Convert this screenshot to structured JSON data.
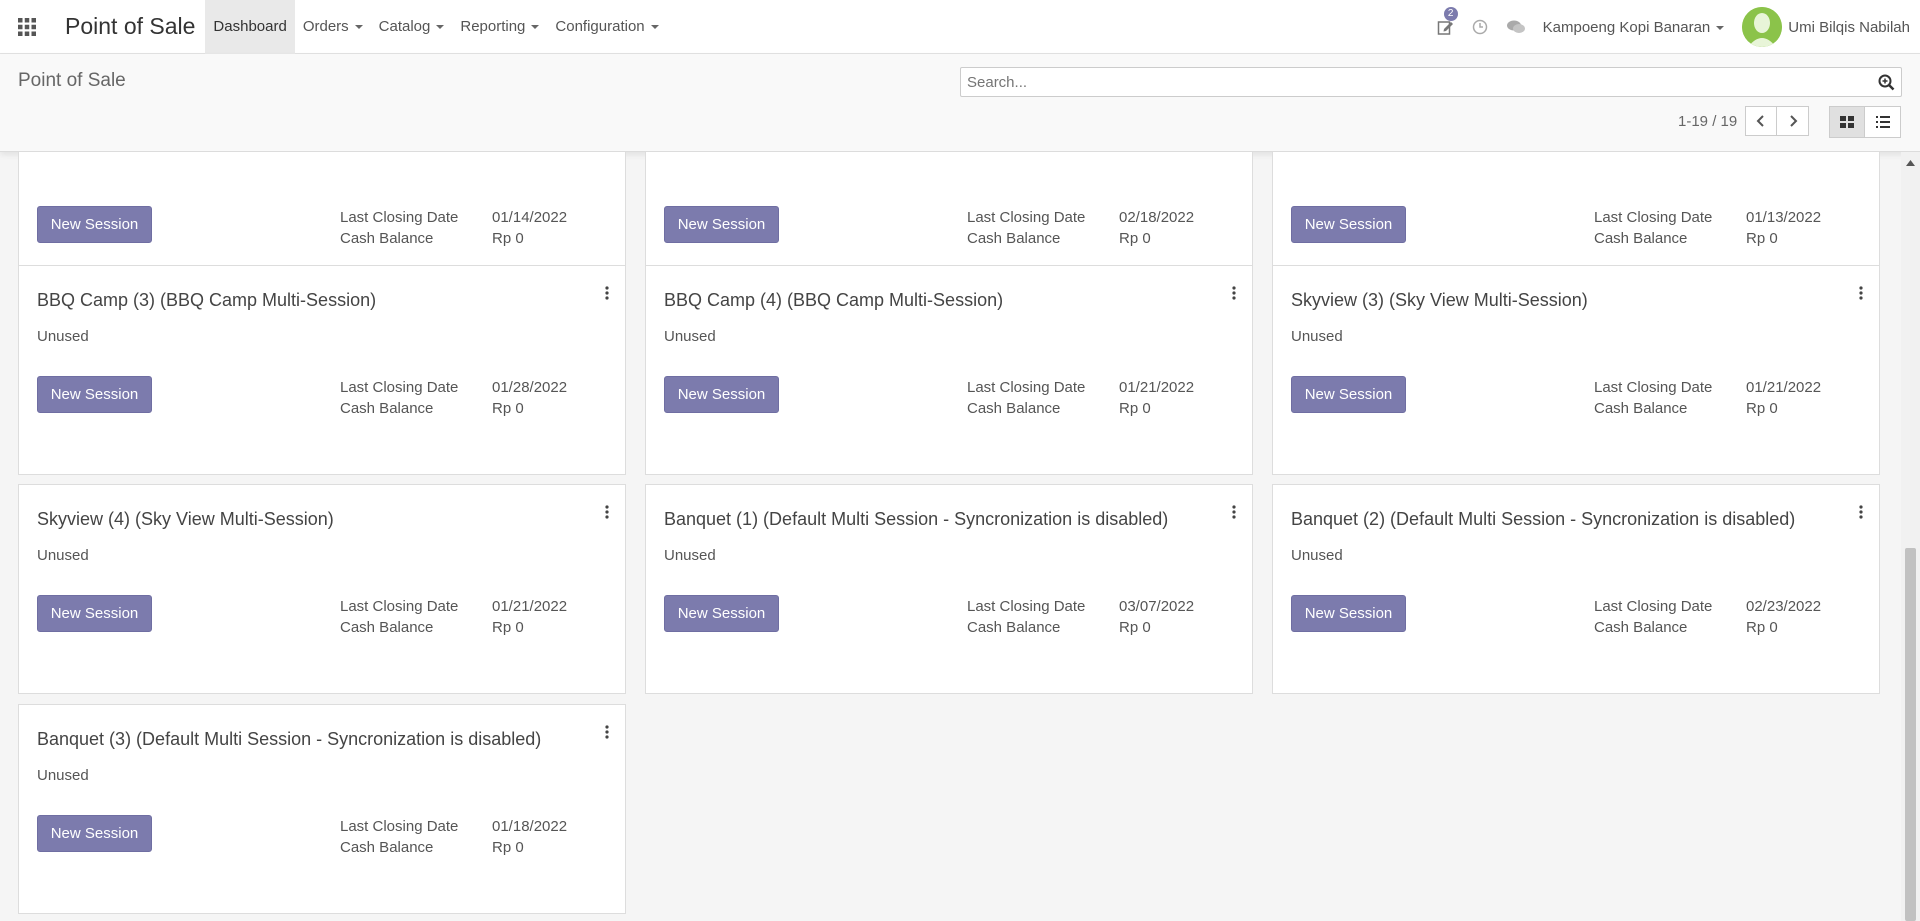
{
  "navbar": {
    "brand": "Point of Sale",
    "menu": [
      {
        "label": "Dashboard",
        "active": true,
        "dropdown": false
      },
      {
        "label": "Orders",
        "active": false,
        "dropdown": true
      },
      {
        "label": "Catalog",
        "active": false,
        "dropdown": true
      },
      {
        "label": "Reporting",
        "active": false,
        "dropdown": true
      },
      {
        "label": "Configuration",
        "active": false,
        "dropdown": true
      }
    ],
    "activity_badge": "2",
    "company": "Kampoeng Kopi Banaran",
    "user": "Umi Bilqis Nabilah"
  },
  "control_panel": {
    "breadcrumb": "Point of Sale",
    "search_placeholder": "Search...",
    "pager": "1-19 / 19"
  },
  "common": {
    "new_session_label": "New Session",
    "last_closing_label": "Last Closing Date",
    "cash_balance_label": "Cash Balance"
  },
  "cards": [
    {
      "title": "",
      "status": "",
      "last_closing": "01/14/2022",
      "cash_balance": "Rp 0"
    },
    {
      "title": "",
      "status": "",
      "last_closing": "02/18/2022",
      "cash_balance": "Rp 0"
    },
    {
      "title": "",
      "status": "",
      "last_closing": "01/13/2022",
      "cash_balance": "Rp 0"
    },
    {
      "title": "BBQ Camp (3) (BBQ Camp Multi-Session)",
      "status": "Unused",
      "last_closing": "01/28/2022",
      "cash_balance": "Rp 0"
    },
    {
      "title": "BBQ Camp (4) (BBQ Camp Multi-Session)",
      "status": "Unused",
      "last_closing": "01/21/2022",
      "cash_balance": "Rp 0"
    },
    {
      "title": "Skyview (3) (Sky View Multi-Session)",
      "status": "Unused",
      "last_closing": "01/21/2022",
      "cash_balance": "Rp 0"
    },
    {
      "title": "Skyview (4) (Sky View Multi-Session)",
      "status": "Unused",
      "last_closing": "01/21/2022",
      "cash_balance": "Rp 0"
    },
    {
      "title": "Banquet (1) (Default Multi Session - Syncronization is disabled)",
      "status": "Unused",
      "last_closing": "03/07/2022",
      "cash_balance": "Rp 0"
    },
    {
      "title": "Banquet (2) (Default Multi Session - Syncronization is disabled)",
      "status": "Unused",
      "last_closing": "02/23/2022",
      "cash_balance": "Rp 0"
    },
    {
      "title": "Banquet (3) (Default Multi Session - Syncronization is disabled)",
      "status": "Unused",
      "last_closing": "01/18/2022",
      "cash_balance": "Rp 0"
    }
  ],
  "colors": {
    "primary": "#7c7bad",
    "card_bg": "#ffffff",
    "page_bg": "#f5f5f5"
  }
}
